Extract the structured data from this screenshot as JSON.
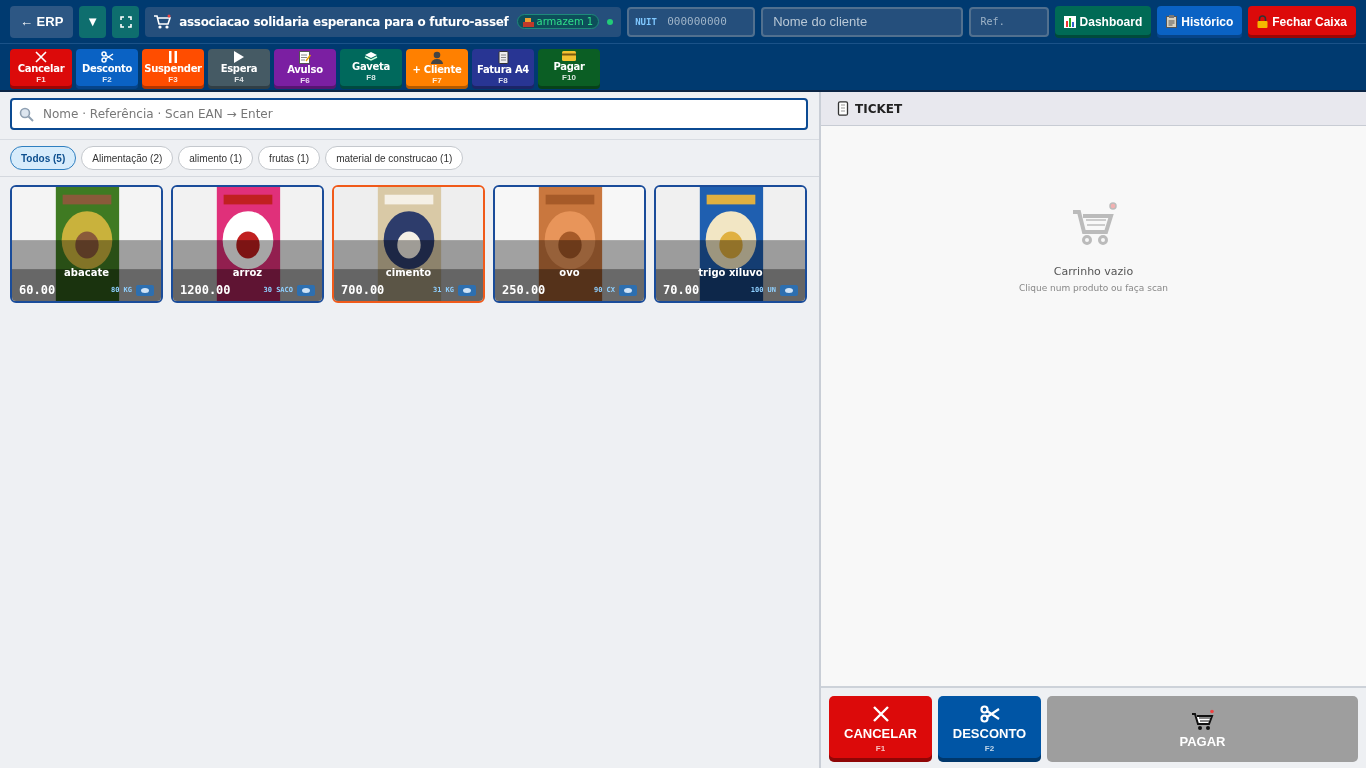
{
  "header": {
    "back_button": "← ERP",
    "menu_button": "▼",
    "store_name": "associacao solidaria esperanca para o futuro-assef",
    "warehouse": "armazem 1",
    "online": true,
    "nuit": {
      "label": "NUIT",
      "placeholder": "000000000"
    },
    "customer": {
      "placeholder": "Nome do cliente"
    },
    "reference": {
      "placeholder": "Ref."
    },
    "buttons": [
      {
        "label": "Dashboard",
        "kind": "chart",
        "color": "#006a55"
      },
      {
        "label": "Histórico",
        "kind": "clipboard",
        "color": "#0a62c4"
      },
      {
        "label": "Fechar Caixa",
        "kind": "lock",
        "color": "#dc0a0a"
      }
    ]
  },
  "actions": [
    {
      "label": "Cancelar",
      "key": "F1",
      "kind": "close",
      "color": "#dc0a0a"
    },
    {
      "label": "Desconto",
      "key": "F2",
      "kind": "scissors",
      "color": "#0a62c4"
    },
    {
      "label": "Suspender",
      "key": "F3",
      "kind": "pause",
      "color": "#ff4d00"
    },
    {
      "label": "Espera",
      "key": "F4",
      "kind": "play",
      "color": "#455a64"
    },
    {
      "label": "Avulso",
      "key": "F6",
      "kind": "note",
      "color": "#7b1fa2"
    },
    {
      "label": "Gaveta",
      "key": "F8",
      "kind": "tray",
      "color": "#00695c"
    },
    {
      "label": "+ Cliente",
      "key": "F7",
      "kind": "person",
      "color": "#ff8000"
    },
    {
      "label": "Fatura A4",
      "key": "F8",
      "kind": "document",
      "color": "#283593"
    },
    {
      "label": "Pagar",
      "key": "F10",
      "kind": "card",
      "color": "#0b5e24"
    }
  ],
  "search": {
    "placeholder": "Nome · Referência · Scan EAN → Enter"
  },
  "categories": [
    {
      "label": "Todos (5)",
      "selected": true
    },
    {
      "label": "Alimentação (2)",
      "selected": false
    },
    {
      "label": "alimento (1)",
      "selected": false
    },
    {
      "label": "frutas (1)",
      "selected": false
    },
    {
      "label": "material de construcao (1)",
      "selected": false
    }
  ],
  "products": [
    {
      "name": "abacate",
      "price": "60.00",
      "stock": "80 KG",
      "selected": false
    },
    {
      "name": "arroz",
      "price": "1200.00",
      "stock": "30 SACO",
      "selected": false
    },
    {
      "name": "cimento",
      "price": "700.00",
      "stock": "31 KG",
      "selected": true
    },
    {
      "name": "ovo",
      "price": "250.00",
      "stock": "90 CX",
      "selected": false
    },
    {
      "name": "trigo xiluvo",
      "price": "70.00",
      "stock": "100 UN",
      "selected": false
    }
  ],
  "ticket": {
    "title": "TICKET",
    "empty_title": "Carrinho vazio",
    "empty_hint": "Clique num produto ou faça scan"
  },
  "footer_buttons": [
    {
      "label": "CANCELAR",
      "key": "F1",
      "kind": "close",
      "color": "#dc0a0a",
      "disabled": false
    },
    {
      "label": "DESCONTO",
      "key": "F2",
      "kind": "scissors",
      "color": "#0055a5",
      "disabled": false
    },
    {
      "label": "PAGAR",
      "kind": "cart",
      "disabled": true
    }
  ]
}
